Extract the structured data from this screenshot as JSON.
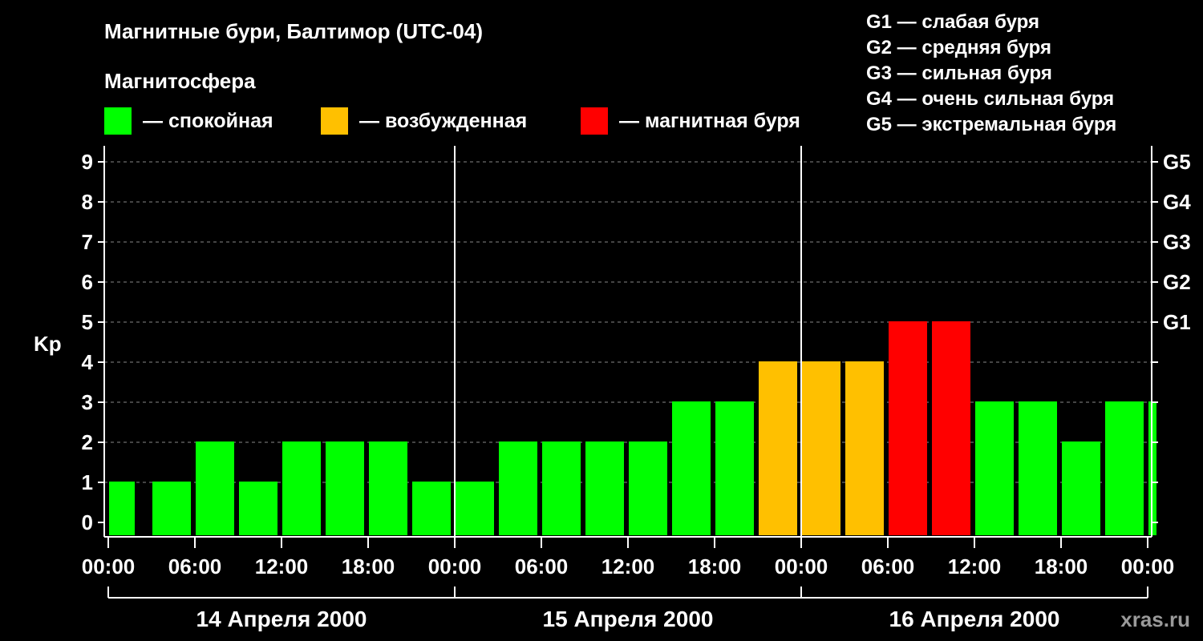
{
  "title": "Магнитные бури, Балтимор (UTC-04)",
  "subtitle": "Магнитосфера",
  "legend": [
    {
      "label": "— спокойная",
      "color": "#00ff00"
    },
    {
      "label": "— возбужденная",
      "color": "#ffc000"
    },
    {
      "label": "— магнитная буря",
      "color": "#ff0000"
    }
  ],
  "g_levels": [
    "G1 — слабая буря",
    "G2 — средняя буря",
    "G3 — сильная буря",
    "G4 — очень сильная буря",
    "G5 — экстремальная буря"
  ],
  "watermark": "xras.ru",
  "colors": {
    "quiet": "#00ff00",
    "active": "#ffc000",
    "storm": "#ff0000",
    "background": "#000000",
    "axis": "#ffffff",
    "grid": "#888888"
  },
  "chart_data": {
    "type": "bar",
    "ylabel": "Kp",
    "ylim": [
      0,
      9
    ],
    "yticks": [
      "0",
      "1",
      "2",
      "3",
      "4",
      "5",
      "6",
      "7",
      "8",
      "9"
    ],
    "right_axis_labels": [
      {
        "kp": 5,
        "label": "G1"
      },
      {
        "kp": 6,
        "label": "G2"
      },
      {
        "kp": 7,
        "label": "G3"
      },
      {
        "kp": 8,
        "label": "G4"
      },
      {
        "kp": 9,
        "label": "G5"
      }
    ],
    "x_tick_labels": [
      "00:00",
      "06:00",
      "12:00",
      "18:00",
      "00:00",
      "06:00",
      "12:00",
      "18:00",
      "00:00",
      "06:00",
      "12:00",
      "18:00",
      "00:00"
    ],
    "days": [
      "14 Апреля 2000",
      "15 Апреля 2000",
      "16 Апреля 2000"
    ],
    "grid": true,
    "bar_interval_hours": 3,
    "values": [
      1,
      1,
      2,
      1,
      2,
      2,
      2,
      1,
      1,
      2,
      2,
      2,
      2,
      3,
      3,
      4,
      4,
      4,
      5,
      5,
      3,
      3,
      2,
      3,
      3
    ],
    "categories_level": [
      "quiet",
      "quiet",
      "quiet",
      "quiet",
      "quiet",
      "quiet",
      "quiet",
      "quiet",
      "quiet",
      "quiet",
      "quiet",
      "quiet",
      "quiet",
      "quiet",
      "quiet",
      "active",
      "active",
      "active",
      "storm",
      "storm",
      "quiet",
      "quiet",
      "quiet",
      "quiet",
      "quiet"
    ]
  }
}
